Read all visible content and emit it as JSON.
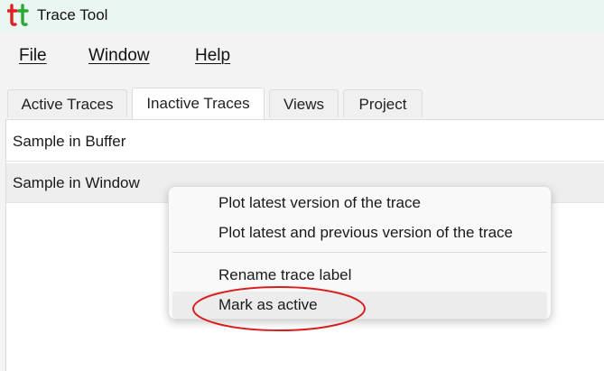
{
  "app": {
    "title": "Trace Tool",
    "logo_icon": "tt-logo-icon",
    "colors": {
      "logo_red": "#e02020",
      "logo_green": "#2aa832",
      "titlebar_bg": "#eaf6f1",
      "highlight": "#d92020"
    }
  },
  "menubar": {
    "items": [
      {
        "label": "File"
      },
      {
        "label": "Window"
      },
      {
        "label": "Help"
      }
    ]
  },
  "tabs": [
    {
      "label": "Active Traces",
      "selected": false
    },
    {
      "label": "Inactive Traces",
      "selected": true
    },
    {
      "label": "Views",
      "selected": false
    },
    {
      "label": "Project",
      "selected": false
    }
  ],
  "list": {
    "rows": [
      {
        "label": "Sample in Buffer",
        "selected": false
      },
      {
        "label": "Sample in Window",
        "selected": true
      }
    ]
  },
  "context_menu": {
    "items": [
      {
        "label": "Plot latest version of the trace"
      },
      {
        "label": "Plot latest and previous version of the trace"
      },
      {
        "label": "Rename trace label"
      },
      {
        "label": "Mark as active",
        "hovered": true,
        "annotated": "red-ellipse"
      }
    ]
  }
}
